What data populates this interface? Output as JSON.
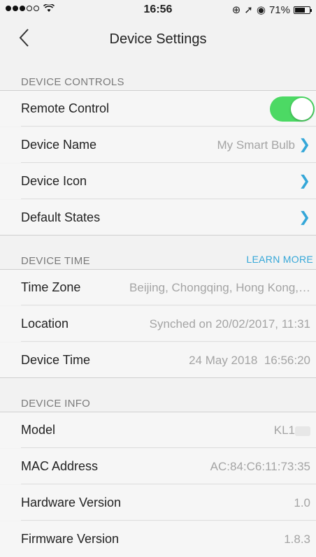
{
  "status_bar": {
    "time": "16:56",
    "battery": "71%",
    "battery_level": 0.71,
    "signal_dots": [
      true,
      true,
      true,
      false,
      false
    ]
  },
  "nav": {
    "back_label": "<",
    "title": "Device Settings"
  },
  "sections": {
    "controls": {
      "header": "DEVICE CONTROLS",
      "remote_control": {
        "label": "Remote Control",
        "enabled": true
      },
      "device_name": {
        "label": "Device Name",
        "value": "My Smart Bulb"
      },
      "device_icon": {
        "label": "Device Icon"
      },
      "default_states": {
        "label": "Default States"
      }
    },
    "time": {
      "header": "DEVICE TIME",
      "learn_more": "LEARN MORE",
      "time_zone": {
        "label": "Time Zone",
        "value": "Beijing, Chongqing, Hong Kong,…"
      },
      "location": {
        "label": "Location",
        "value": "Synched on 20/02/2017, 11:31"
      },
      "device_time": {
        "label": "Device Time",
        "value": "24 May 2018  16:56:20"
      }
    },
    "info": {
      "header": "DEVICE INFO",
      "model": {
        "label": "Model",
        "value": "KL1"
      },
      "mac": {
        "label": "MAC Address",
        "value": "AC:84:C6:11:73:35"
      },
      "hardware": {
        "label": "Hardware Version",
        "value": "1.0"
      },
      "firmware": {
        "label": "Firmware Version",
        "value": "1.8.3"
      }
    }
  },
  "colors": {
    "accent": "#35a7d8",
    "toggle_on": "#4cd964",
    "background": "#f2f2f2"
  },
  "icons": {
    "chevron": "chevron-right-icon",
    "back": "chevron-left-icon",
    "wifi": "wifi-icon",
    "lock": "rotation-lock-icon",
    "location": "location-arrow-icon",
    "alarm": "alarm-icon",
    "battery": "battery-icon"
  }
}
